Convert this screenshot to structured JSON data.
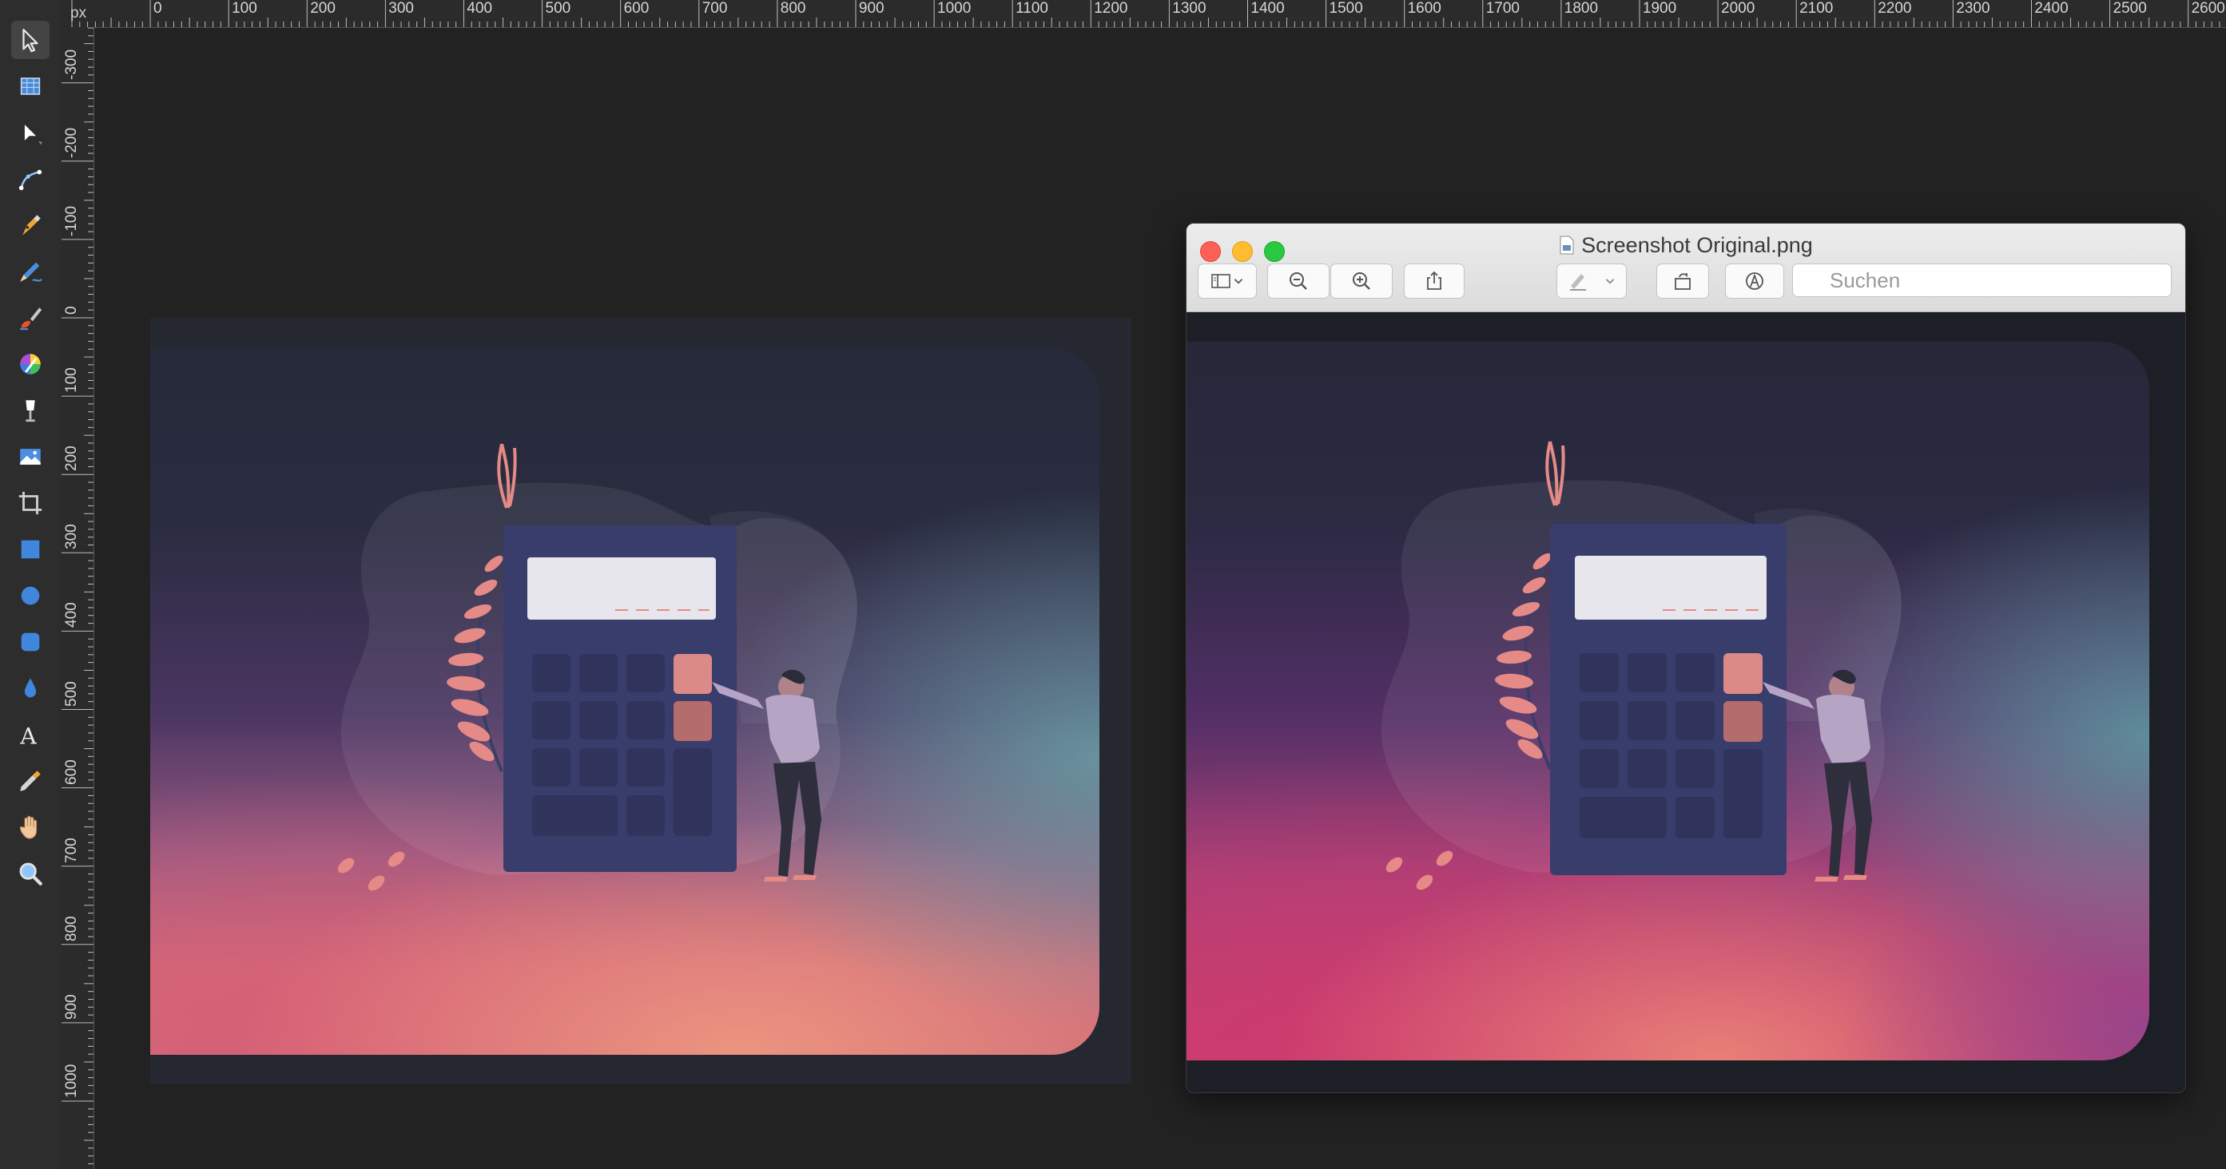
{
  "ruler": {
    "unit": "px",
    "top_labels": [
      "0",
      "100",
      "200",
      "300",
      "400",
      "500",
      "600",
      "700",
      "800",
      "900",
      "1000",
      "1100",
      "1200",
      "1300",
      "1400",
      "1500",
      "1600",
      "1700",
      "1800",
      "1900",
      "2000",
      "2100",
      "2200",
      "2300",
      "2400",
      "2500",
      "2600"
    ],
    "left_labels": [
      "-300",
      "-200",
      "-100",
      "0",
      "100",
      "200",
      "300",
      "400",
      "500",
      "600",
      "700",
      "800",
      "900",
      "1000"
    ]
  },
  "tools": [
    {
      "icon": "move-tool-icon",
      "active": true
    },
    {
      "icon": "artboard-tool-icon"
    },
    {
      "icon": "node-tool-icon"
    },
    {
      "icon": "corner-tool-icon"
    },
    {
      "icon": "pen-tool-icon"
    },
    {
      "icon": "pencil-tool-icon"
    },
    {
      "icon": "vector-brush-tool-icon"
    },
    {
      "icon": "color-picker-tool-icon"
    },
    {
      "icon": "fill-tool-icon"
    },
    {
      "icon": "place-image-tool-icon"
    },
    {
      "icon": "crop-tool-icon"
    },
    {
      "icon": "rectangle-tool-icon"
    },
    {
      "icon": "ellipse-tool-icon"
    },
    {
      "icon": "rounded-rectangle-tool-icon"
    },
    {
      "icon": "transparency-tool-icon"
    },
    {
      "icon": "text-tool-icon"
    },
    {
      "icon": "eyedropper-tool-icon"
    },
    {
      "icon": "hand-tool-icon"
    },
    {
      "icon": "zoom-tool-icon"
    }
  ],
  "preview": {
    "title": "Screenshot Original.png",
    "search_placeholder": "Suchen",
    "buttons": [
      "sidebar-toggle",
      "zoom-out",
      "zoom-in",
      "share",
      "markup",
      "rotate",
      "annotate"
    ]
  },
  "colors": {
    "accent_pink": "#e58a86",
    "calculator": "#393d6b",
    "traffic_close": "#fe5f57",
    "traffic_min": "#febc2e",
    "traffic_max": "#28c840"
  }
}
